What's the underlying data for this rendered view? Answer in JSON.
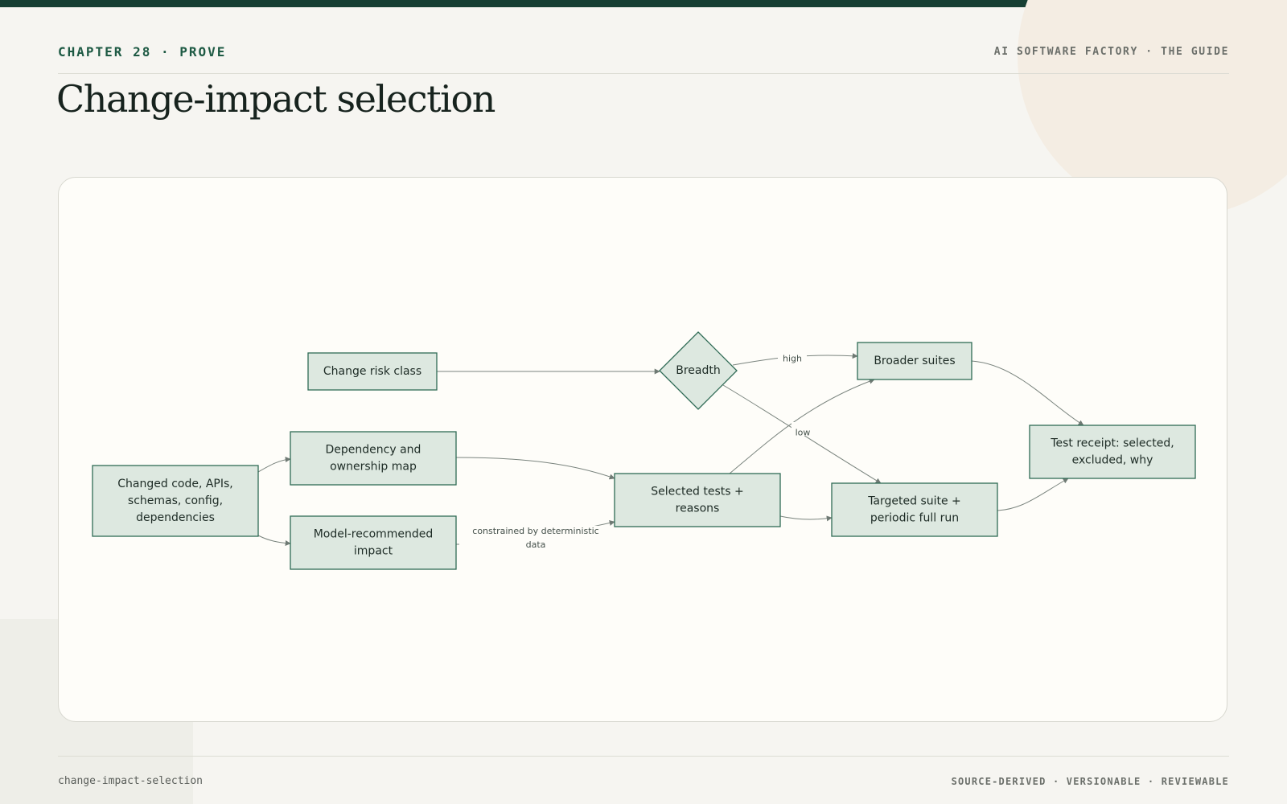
{
  "header": {
    "chapter": "CHAPTER 28 · PROVE",
    "guide": "AI SOFTWARE FACTORY · THE GUIDE"
  },
  "title": "Change-impact selection",
  "diagram": {
    "nodes": [
      {
        "id": "changed",
        "label": [
          "Changed code, APIs,",
          "schemas, config,",
          "dependencies"
        ]
      },
      {
        "id": "depmap",
        "label": [
          "Dependency and",
          "ownership map"
        ]
      },
      {
        "id": "model",
        "label": [
          "Model-recommended",
          "impact"
        ]
      },
      {
        "id": "risk",
        "label": [
          "Change risk class"
        ]
      },
      {
        "id": "selected",
        "label": [
          "Selected tests +",
          "reasons"
        ]
      },
      {
        "id": "breadth",
        "label": [
          "Breadth"
        ]
      },
      {
        "id": "broader",
        "label": [
          "Broader suites"
        ]
      },
      {
        "id": "targeted",
        "label": [
          "Targeted suite +",
          "periodic full run"
        ]
      },
      {
        "id": "receipt",
        "label": [
          "Test receipt: selected,",
          "excluded, why"
        ]
      }
    ],
    "edges": [
      {
        "from": "changed",
        "to": "depmap",
        "label": []
      },
      {
        "from": "changed",
        "to": "model",
        "label": []
      },
      {
        "from": "depmap",
        "to": "selected",
        "label": []
      },
      {
        "from": "model",
        "to": "selected",
        "label": [
          "constrained by deterministic",
          "data"
        ]
      },
      {
        "from": "risk",
        "to": "breadth",
        "label": []
      },
      {
        "from": "breadth",
        "to": "broader",
        "label": [
          "high"
        ]
      },
      {
        "from": "breadth",
        "to": "targeted",
        "label": [
          "low"
        ]
      },
      {
        "from": "selected",
        "to": "broader",
        "label": []
      },
      {
        "from": "selected",
        "to": "targeted",
        "label": []
      },
      {
        "from": "broader",
        "to": "receipt",
        "label": []
      },
      {
        "from": "targeted",
        "to": "receipt",
        "label": []
      }
    ]
  },
  "footer": {
    "slug": "change-impact-selection",
    "tagline": "SOURCE-DERIVED · VERSIONABLE · REVIEWABLE"
  },
  "colors": {
    "node_fill": "#dde8e0",
    "node_stroke": "#2f6b55",
    "edge": "#7a847e",
    "accent": "#163f33"
  }
}
